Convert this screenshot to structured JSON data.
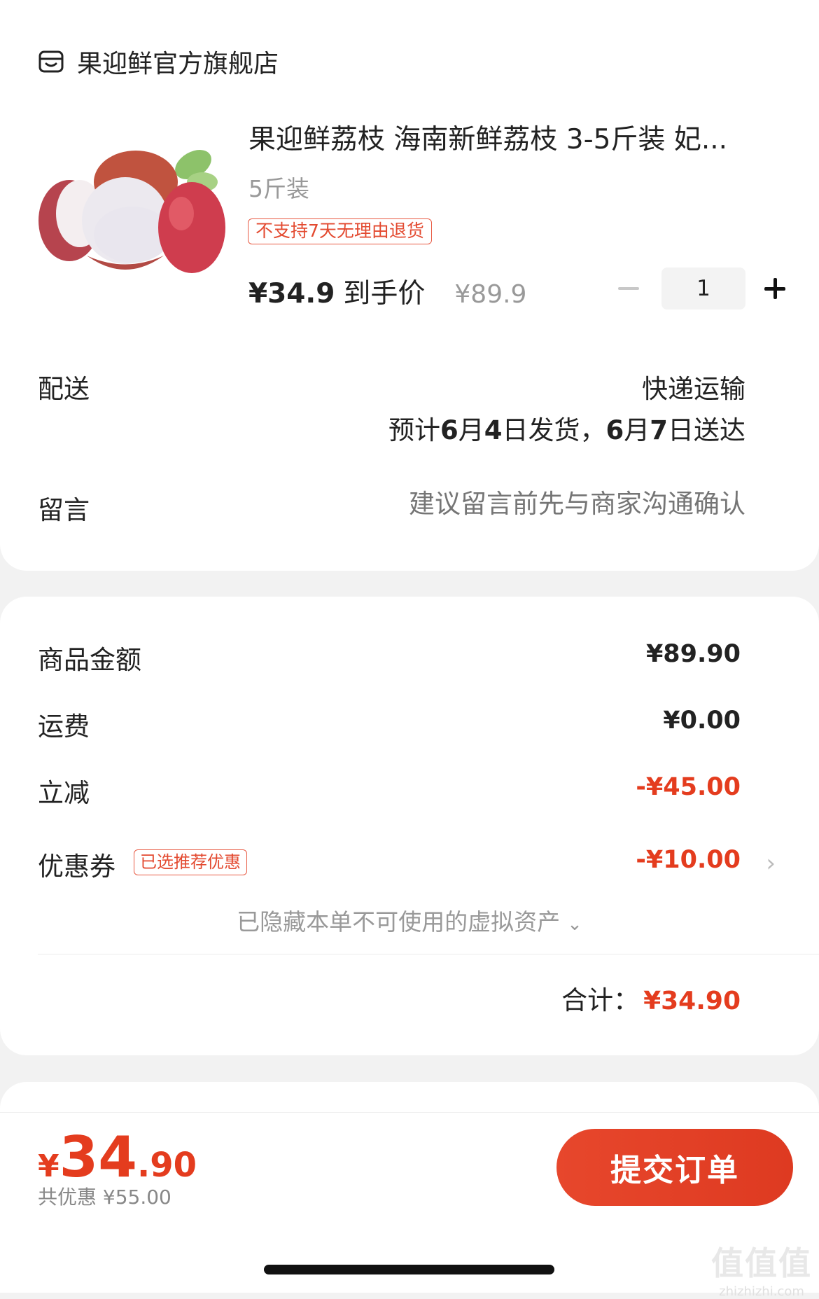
{
  "store": {
    "name": "果迎鲜官方旗舰店",
    "icon": "store-icon"
  },
  "product": {
    "title": "果迎鲜荔枝 海南新鲜荔枝 3-5斤装 妃...",
    "sku": "5斤装",
    "return_tag": "不支持7天无理由退货",
    "price": "¥34.9",
    "price_suffix": "到手价",
    "original_price": "¥89.9",
    "quantity": "1"
  },
  "delivery": {
    "label": "配送",
    "method": "快递运输",
    "eta_prefix": "预计",
    "ship_month": "6",
    "month_char_1": "月",
    "ship_day": "4",
    "eta_mid": "日发货，",
    "arrive_month": "6",
    "month_char_2": "月",
    "arrive_day": "7",
    "eta_end": "日送达"
  },
  "message": {
    "label": "留言",
    "placeholder": "建议留言前先与商家沟通确认"
  },
  "fees": {
    "goods_label": "商品金额",
    "goods_value": "¥89.90",
    "shipping_label": "运费",
    "shipping_value": "¥0.00",
    "discount_label": "立减",
    "discount_value": "-¥45.00",
    "coupon_label": "优惠券",
    "coupon_tag": "已选推荐优惠",
    "coupon_value": "-¥10.00"
  },
  "hidden_assets": "已隐藏本单不可使用的虚拟资产",
  "total": {
    "label": "合计：",
    "value": "¥34.90"
  },
  "bottom": {
    "yen": "¥",
    "int": "34",
    "dec": ".90",
    "saving": "共优惠 ¥55.00",
    "submit_label": "提交订单"
  },
  "watermark": {
    "logo": "值值值",
    "url": "zhizhizhi.com"
  },
  "colors": {
    "accent": "#e43c1e",
    "muted": "#999999"
  }
}
